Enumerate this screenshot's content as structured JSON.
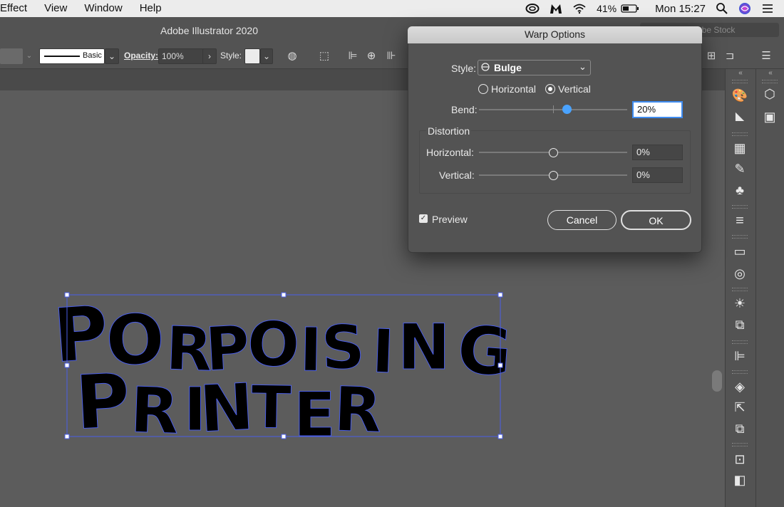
{
  "menubar": {
    "items": [
      "Effect",
      "View",
      "Window",
      "Help"
    ],
    "battery": "41%",
    "clock": "Mon 15:27"
  },
  "app": {
    "title": "Adobe Illustrator 2020",
    "stock_search_placeholder": "obe Stock"
  },
  "controlbar": {
    "stroke_profile": "Basic",
    "opacity_label": "Opacity:",
    "opacity_value": "100%",
    "style_label": "Style:"
  },
  "dialog": {
    "title": "Warp Options",
    "style_label": "Style:",
    "style_value": "Bulge",
    "orientation_options": [
      "Horizontal",
      "Vertical"
    ],
    "orientation_selected": "Vertical",
    "bend_label": "Bend:",
    "bend_value": "20%",
    "distortion_heading": "Distortion",
    "distortion_horizontal_label": "Horizontal:",
    "distortion_horizontal_value": "0%",
    "distortion_vertical_label": "Vertical:",
    "distortion_vertical_value": "0%",
    "preview_label": "Preview",
    "preview_checked": true,
    "cancel_label": "Cancel",
    "ok_label": "OK"
  },
  "artwork": {
    "line1_letters": [
      "P",
      "O",
      "R",
      "P",
      "O",
      "I",
      "S",
      "I",
      "N",
      "G"
    ],
    "line2_letters": [
      "P",
      "R",
      "I",
      "N",
      "T",
      "E",
      "R"
    ]
  },
  "colors": {
    "selection": "#4a5ee8",
    "accent": "#4aa3ff"
  }
}
